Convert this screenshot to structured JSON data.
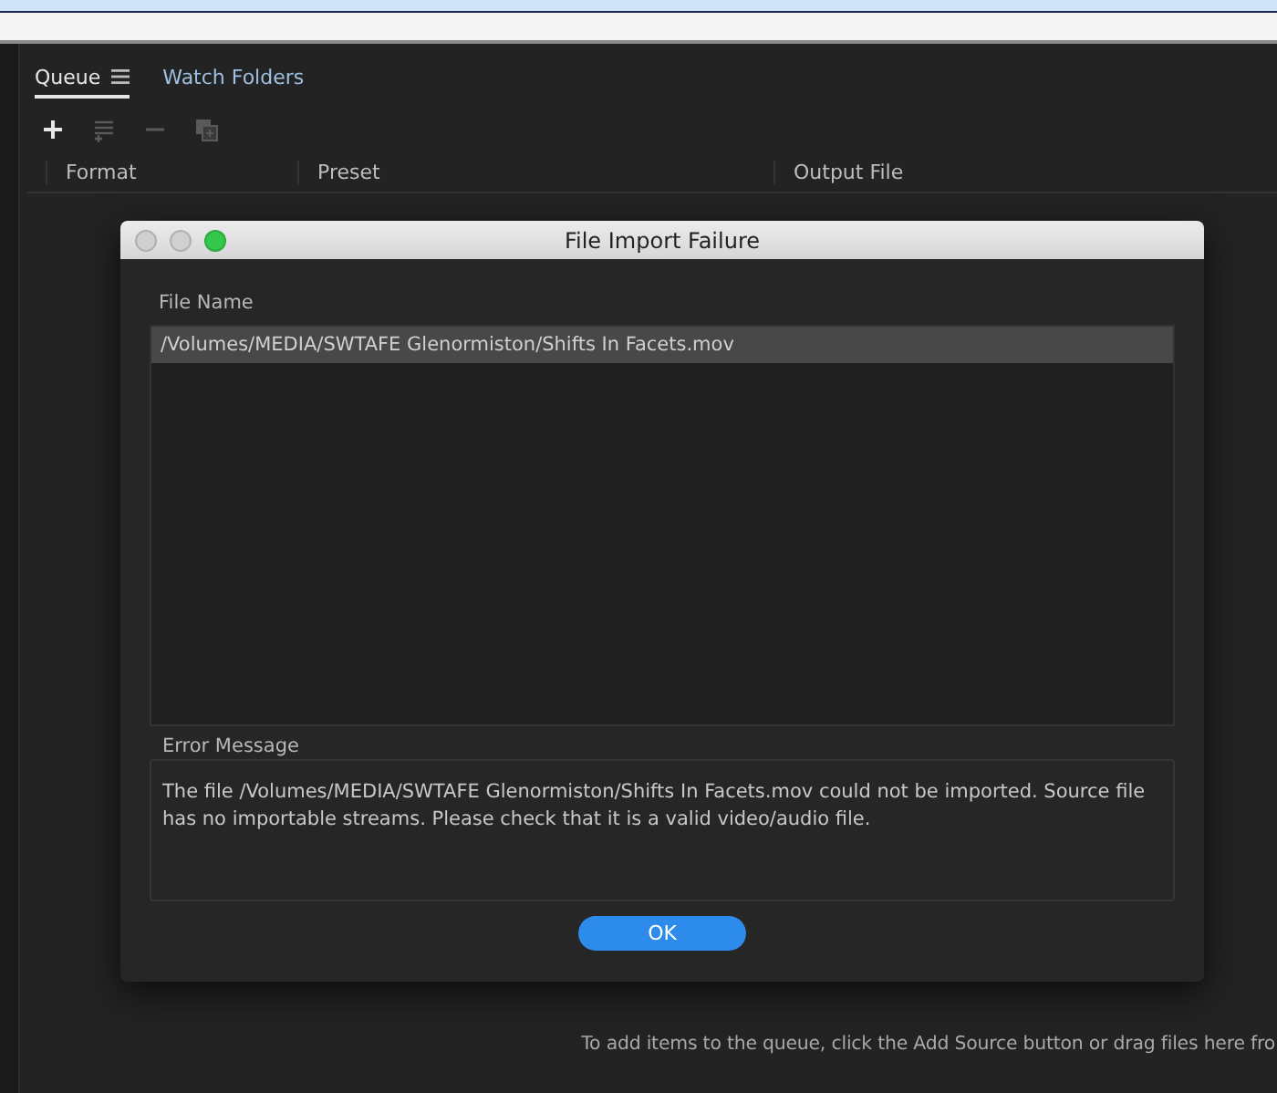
{
  "tabs": [
    {
      "label": "Queue",
      "selected": true,
      "has_menu": true
    },
    {
      "label": "Watch Folders",
      "selected": false,
      "has_menu": false
    }
  ],
  "toolbar": [
    {
      "kind": "add",
      "disabled": false
    },
    {
      "kind": "settings",
      "disabled": true
    },
    {
      "kind": "remove",
      "disabled": true
    },
    {
      "kind": "duplicate",
      "disabled": true
    }
  ],
  "columns": [
    "Format",
    "Preset",
    "Output File"
  ],
  "empty_hint": "To add items to the queue, click the Add Source button or drag files here fro",
  "dialog": {
    "title": "File Import Failure",
    "traffic_lights": [
      {
        "kind": "close",
        "active": false
      },
      {
        "kind": "minimize",
        "active": false
      },
      {
        "kind": "zoom",
        "active": true
      }
    ],
    "file_list_label": "File Name",
    "files": [
      {
        "path": "/Volumes/MEDIA/SWTAFE Glenormiston/Shifts In Facets.mov",
        "selected": true
      }
    ],
    "error_label": "Error Message",
    "error_message": "The file /Volumes/MEDIA/SWTAFE Glenormiston/Shifts In Facets.mov could not be imported. Source file has no importable streams. Please check that it is a valid video/audio file.",
    "button": "OK"
  }
}
